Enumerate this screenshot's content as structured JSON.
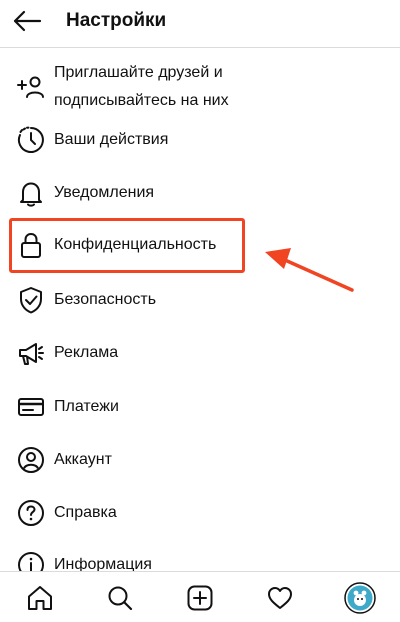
{
  "header": {
    "title": "Настройки",
    "back_icon": "arrow-left-icon"
  },
  "menu": {
    "items": [
      {
        "label_line1": "Приглашайте друзей и",
        "label_line2": "подписывайтесь на них",
        "icon": "add-person-icon"
      },
      {
        "label": "Ваши действия",
        "icon": "activity-clock-icon"
      },
      {
        "label": "Уведомления",
        "icon": "bell-icon"
      },
      {
        "label": "Конфиденциальность",
        "icon": "lock-icon"
      },
      {
        "label": "Безопасность",
        "icon": "shield-check-icon"
      },
      {
        "label": "Реклама",
        "icon": "megaphone-icon"
      },
      {
        "label": "Платежи",
        "icon": "card-icon"
      },
      {
        "label": "Аккаунт",
        "icon": "person-circle-icon"
      },
      {
        "label": "Справка",
        "icon": "question-circle-icon"
      },
      {
        "label": "Информация",
        "icon": "info-circle-icon"
      }
    ]
  },
  "tabbar": {
    "tabs": [
      "home-icon",
      "search-icon",
      "add-post-icon",
      "heart-icon",
      "profile-avatar"
    ]
  },
  "colors": {
    "highlight": "#f04423",
    "divider": "#dbdbdb",
    "avatar": "#3fa9c9"
  }
}
